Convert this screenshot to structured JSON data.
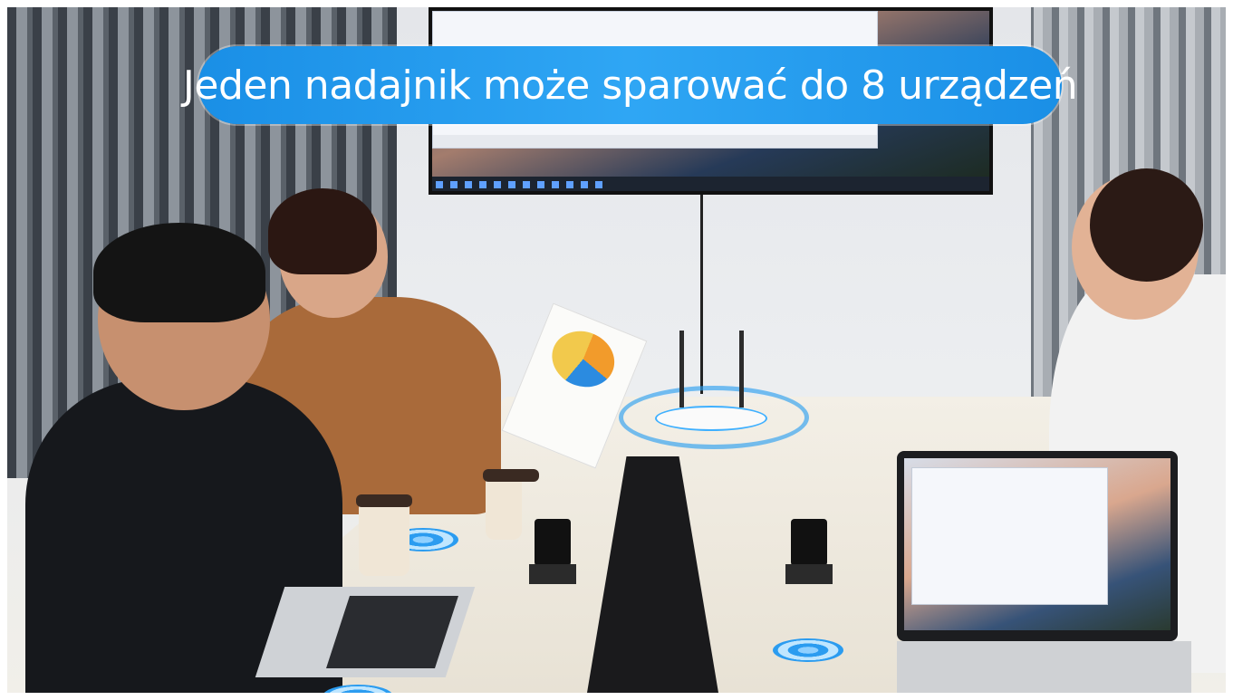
{
  "headline": {
    "text": "Jeden nadajnik może sparować do 8 urządzeń"
  },
  "colors": {
    "banner": "#2fa6f4",
    "banner_text": "#ffffff",
    "signal": "#2b9cf0"
  },
  "scene": {
    "description_icons": [
      "router-icon",
      "transmitter-icon",
      "receiver-icon"
    ]
  }
}
